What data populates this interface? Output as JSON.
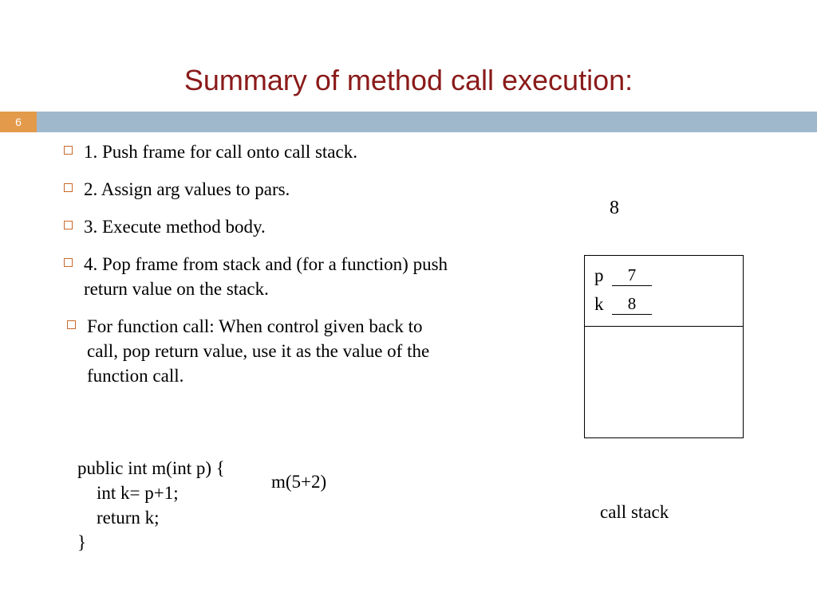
{
  "page_number": "6",
  "title": "Summary of method call execution:",
  "bullets": [
    "1. Push frame for call onto call stack.",
    "2. Assign arg values to pars.",
    "3. Execute method body.",
    "4. Pop frame from stack and (for a function) push return value on the stack.",
    "For function call: When control given back to call, pop return value, use it as the value of the function call."
  ],
  "code": {
    "l1": "public int m(int p) {",
    "l2": "int k= p+1;",
    "l3": "return k;",
    "l4": "}"
  },
  "call_expression": "m(5+2)",
  "return_value": "8",
  "frame": {
    "var1_name": "p",
    "var1_val": "7",
    "var2_name": "k",
    "var2_val": "8"
  },
  "stack_label": "call stack"
}
